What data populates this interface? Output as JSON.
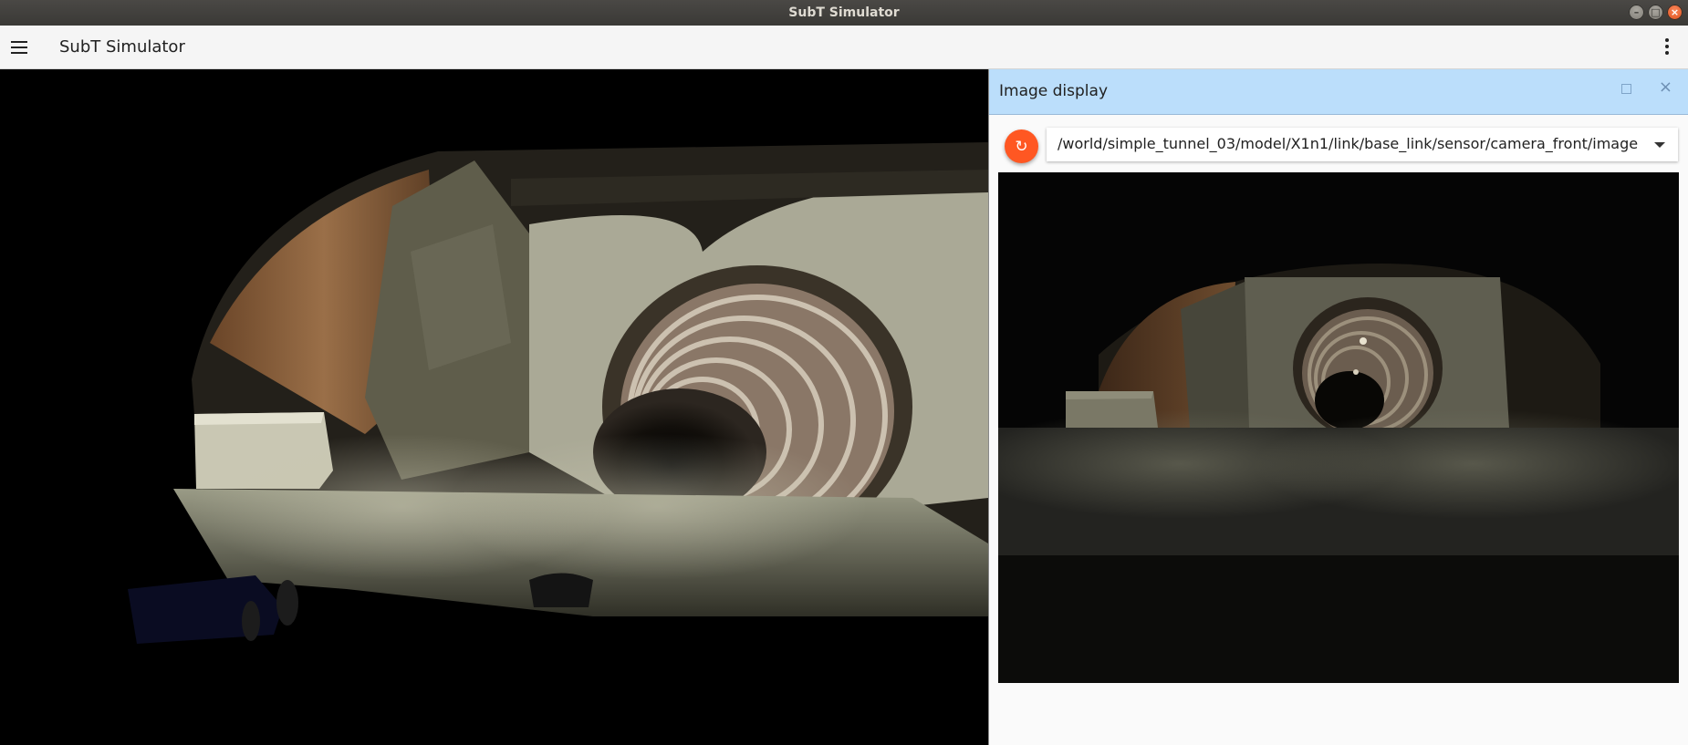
{
  "window": {
    "title": "SubT Simulator",
    "controls": {
      "minimize": "–",
      "maximize": "□",
      "close": "×"
    }
  },
  "appbar": {
    "menu_icon": "hamburger-menu-icon",
    "title": "SubT Simulator",
    "more_icon": "more-vertical-icon"
  },
  "panel": {
    "title": "Image display",
    "maximize_icon": "maximize-icon",
    "close_glyph": "×",
    "refresh_glyph": "↻",
    "topic": "/world/simple_tunnel_03/model/X1n1/link/base_link/sensor/camera_front/image"
  },
  "colors": {
    "appbar": "#f5f5f5",
    "panel_header": "#bbdefb",
    "refresh_button": "#ff5722",
    "close_button": "#e95420"
  }
}
